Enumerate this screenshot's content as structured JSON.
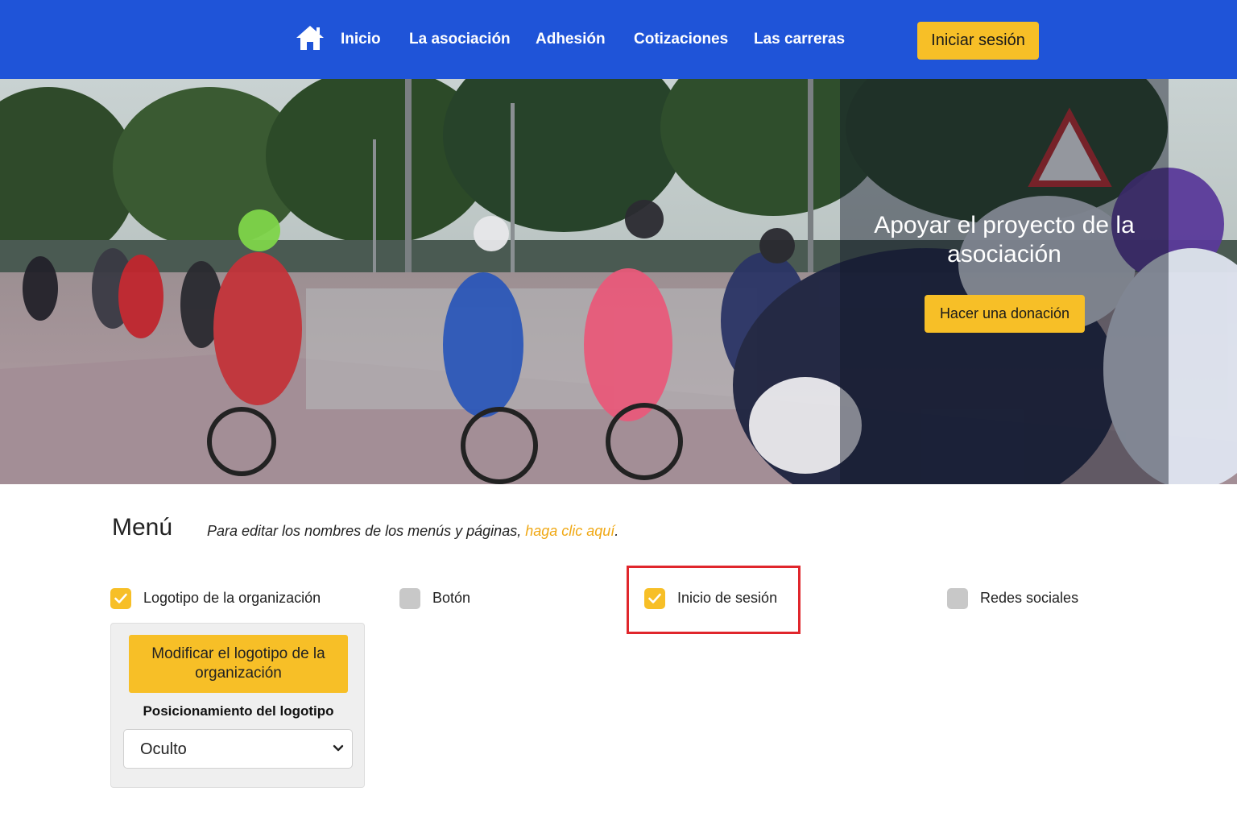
{
  "nav": {
    "items": [
      "Inicio",
      "La asociación",
      "Adhesión",
      "Cotizaciones",
      "Las carreras"
    ],
    "login_label": "Iniciar sesión",
    "home_icon": "home-icon"
  },
  "hero": {
    "title": "Apoyar el proyecto de la asociación",
    "donate_label": "Hacer una donación"
  },
  "menu": {
    "title": "Menú",
    "hint_prefix": "Para editar los nombres de los menús y páginas, ",
    "hint_link": "haga clic aquí",
    "hint_suffix": ".",
    "options": [
      {
        "label": "Logotipo de la organización",
        "checked": true
      },
      {
        "label": "Botón",
        "checked": false
      },
      {
        "label": "Inicio de sesión",
        "checked": true
      },
      {
        "label": "Redes sociales",
        "checked": false
      }
    ],
    "logo_panel": {
      "modify_label": "Modificar el logotipo de la organización",
      "position_label": "Posicionamiento del logotipo",
      "position_value": "Oculto"
    }
  },
  "colors": {
    "nav_bg": "#1f54d8",
    "accent": "#f7bf27",
    "link": "#f0a814",
    "highlight": "#e0262c",
    "checkbox_off": "#c8c8c8"
  }
}
